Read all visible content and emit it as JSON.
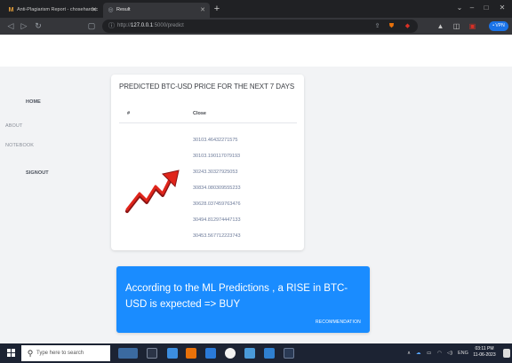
{
  "browser": {
    "tabs": [
      {
        "label": "Anti-Plagiarism Report - chosehardcc",
        "icon": "gmail-icon"
      },
      {
        "label": "Result",
        "icon": "globe-icon"
      }
    ],
    "new_tab": "+",
    "window_controls": {
      "minimize": "–",
      "maximize": "□",
      "close": "✕"
    },
    "url_prefix": "http://",
    "url_host": "127.0.0.1",
    "url_path": ":5000/predict",
    "vpn_label": "• VPN"
  },
  "sidebar": {
    "items": [
      {
        "label": "HOME"
      },
      {
        "label": "ABOUT"
      },
      {
        "label": "NOTEBOOK"
      },
      {
        "label": "SIGNOUT"
      }
    ]
  },
  "prediction_card": {
    "title": "PREDICTED BTC-USD PRICE FOR THE NEXT 7 DAYS",
    "columns": [
      "#",
      "Close"
    ],
    "rows": [
      "30103.46432271575",
      "30103.190117079193",
      "30243.30327925053",
      "30834.080309555233",
      "30628.037459763476",
      "30494.812974447133",
      "30453.567712223743"
    ]
  },
  "recommendation": {
    "text": "According to the ML Predictions , a RISE in BTC-USD is expected => BUY",
    "label": "RECOMMENDATION",
    "color": "#1a8cff"
  },
  "taskbar": {
    "search_placeholder": "Type here to search",
    "tray_lang": "ENG",
    "time": "03:11 PM",
    "date": "11-06-2023"
  }
}
